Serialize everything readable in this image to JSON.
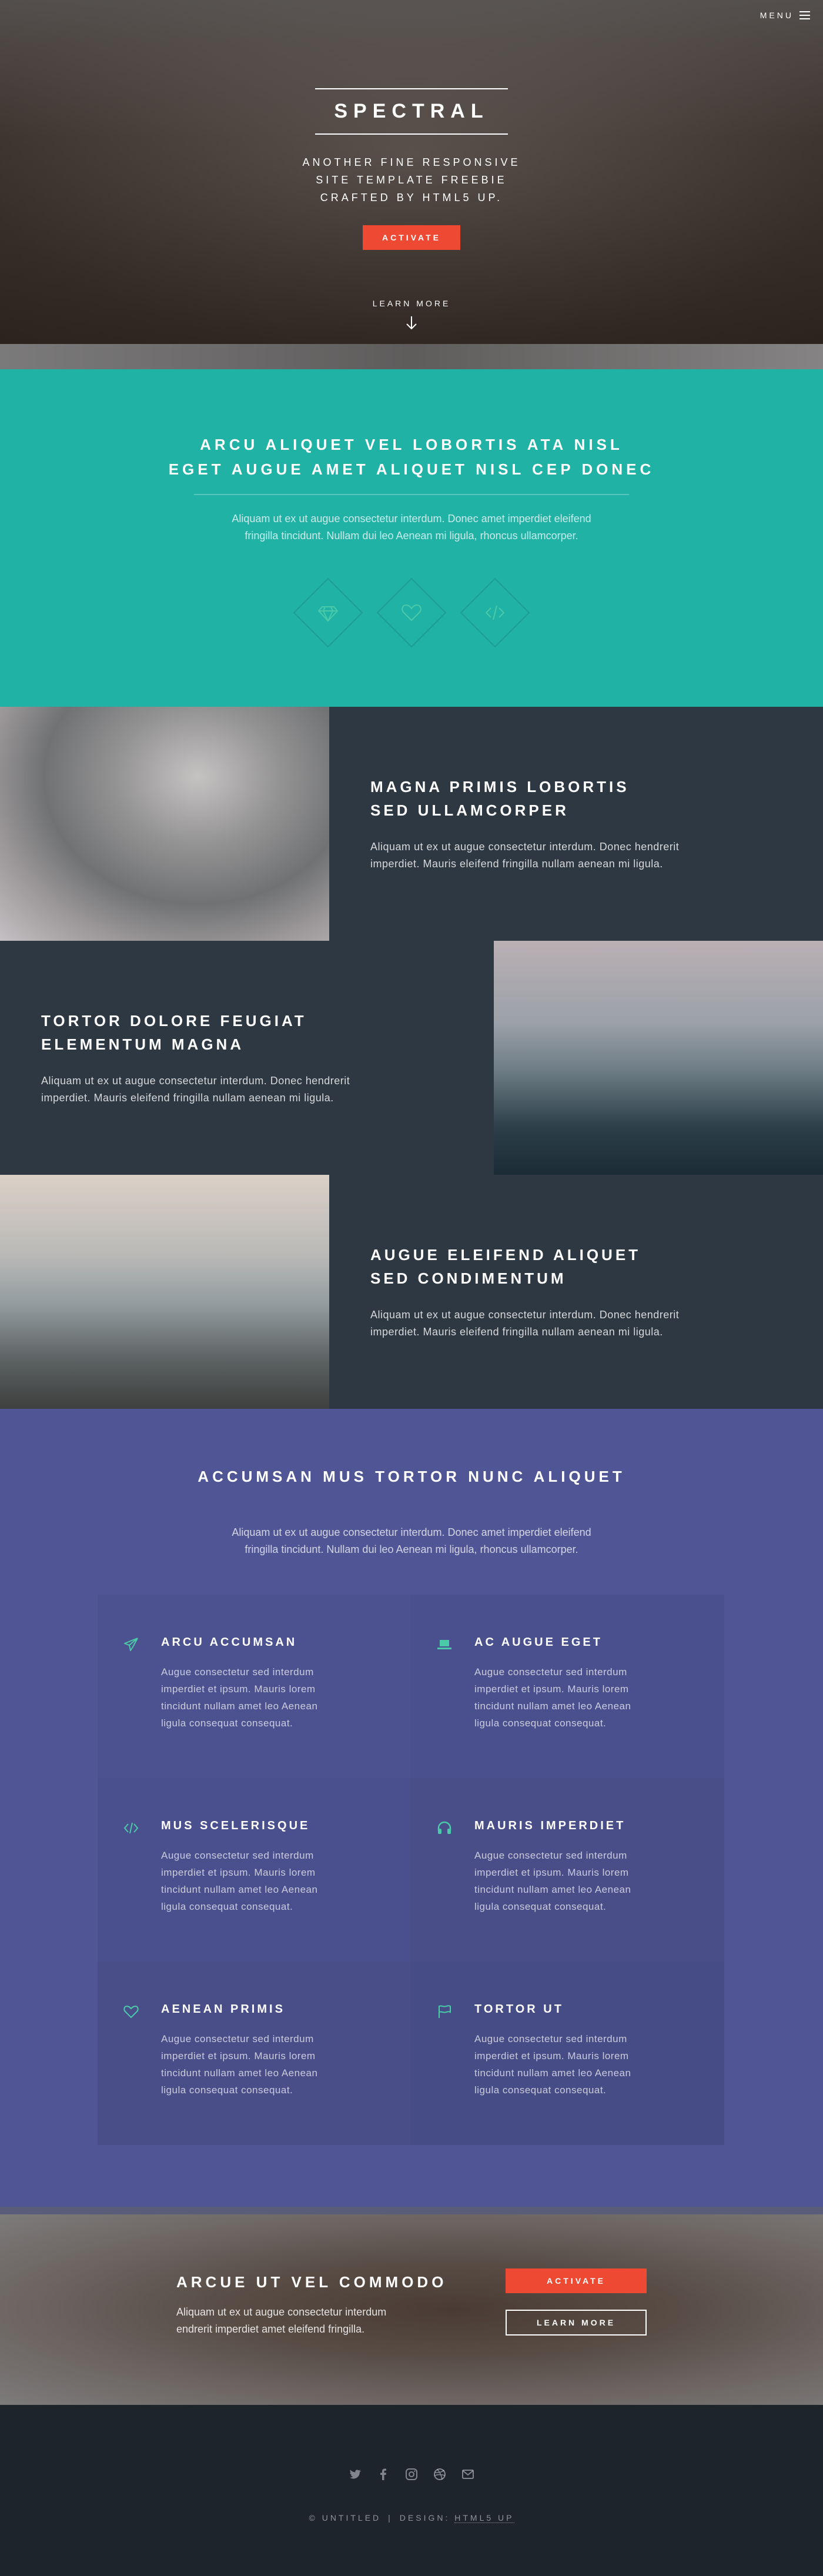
{
  "colors": {
    "accent": "#ed4933",
    "teal": "#21b2a6",
    "purple": "#4f5595",
    "dark": "#2e3842",
    "footer": "#1d242a",
    "icon_teal": "#4acaa8"
  },
  "header": {
    "menu_label": "MENU",
    "menu_icon": "hamburger-icon"
  },
  "banner": {
    "title": "SPECTRAL",
    "tagline_lines": [
      "ANOTHER FINE RESPONSIVE",
      "SITE TEMPLATE FREEBIE",
      "CRAFTED BY HTML5 UP."
    ],
    "activate_label": "ACTIVATE",
    "learn_more_label": "LEARN MORE",
    "learn_more_icon": "arrow-down-icon"
  },
  "one": {
    "heading_lines": [
      "ARCU ALIQUET VEL LOBORTIS ATA NISL",
      "EGET AUGUE AMET ALIQUET NISL CEP DONEC"
    ],
    "text_lines": [
      "Aliquam ut ex ut augue consectetur interdum. Donec amet imperdiet eleifend",
      "fringilla tincidunt. Nullam dui leo Aenean mi ligula, rhoncus ullamcorper."
    ],
    "icons": [
      "diamond-icon",
      "heart-icon",
      "code-icon"
    ]
  },
  "spotlights": [
    {
      "title_lines": [
        "MAGNA PRIMIS LOBORTIS",
        "SED ULLAMCORPER"
      ],
      "text_lines": [
        "Aliquam ut ex ut augue consectetur interdum. Donec hendrerit",
        "imperdiet. Mauris eleifend fringilla nullam aenean mi ligula."
      ]
    },
    {
      "title_lines": [
        "TORTOR DOLORE FEUGIAT",
        "ELEMENTUM MAGNA"
      ],
      "text_lines": [
        "Aliquam ut ex ut augue consectetur interdum. Donec hendrerit",
        "imperdiet. Mauris eleifend fringilla nullam aenean mi ligula."
      ]
    },
    {
      "title_lines": [
        "AUGUE ELEIFEND ALIQUET",
        "SED CONDIMENTUM"
      ],
      "text_lines": [
        "Aliquam ut ex ut augue consectetur interdum. Donec hendrerit",
        "imperdiet. Mauris eleifend fringilla nullam aenean mi ligula."
      ]
    }
  ],
  "three": {
    "heading": "ACCUMSAN MUS TORTOR NUNC ALIQUET",
    "text_lines": [
      "Aliquam ut ex ut augue consectetur interdum. Donec amet imperdiet eleifend",
      "fringilla tincidunt. Nullam dui leo Aenean mi ligula, rhoncus ullamcorper."
    ],
    "features": [
      {
        "icon": "paper-plane-icon",
        "title": "ARCU ACCUMSAN",
        "text_lines": [
          "Augue consectetur sed interdum",
          "imperdiet et ipsum. Mauris lorem",
          "tincidunt nullam amet leo Aenean",
          "ligula consequat consequat."
        ]
      },
      {
        "icon": "laptop-icon",
        "title": "AC AUGUE EGET",
        "text_lines": [
          "Augue consectetur sed interdum",
          "imperdiet et ipsum. Mauris lorem",
          "tincidunt nullam amet leo Aenean",
          "ligula consequat consequat."
        ]
      },
      {
        "icon": "code-icon",
        "title": "MUS SCELERISQUE",
        "text_lines": [
          "Augue consectetur sed interdum",
          "imperdiet et ipsum. Mauris lorem",
          "tincidunt nullam amet leo Aenean",
          "ligula consequat consequat."
        ]
      },
      {
        "icon": "headphones-icon",
        "title": "MAURIS IMPERDIET",
        "text_lines": [
          "Augue consectetur sed interdum",
          "imperdiet et ipsum. Mauris lorem",
          "tincidunt nullam amet leo Aenean",
          "ligula consequat consequat."
        ]
      },
      {
        "icon": "heart-icon",
        "title": "AENEAN PRIMIS",
        "text_lines": [
          "Augue consectetur sed interdum",
          "imperdiet et ipsum. Mauris lorem",
          "tincidunt nullam amet leo Aenean",
          "ligula consequat consequat."
        ]
      },
      {
        "icon": "flag-icon",
        "title": "TORTOR UT",
        "text_lines": [
          "Augue consectetur sed interdum",
          "imperdiet et ipsum. Mauris lorem",
          "tincidunt nullam amet leo Aenean",
          "ligula consequat consequat."
        ]
      }
    ]
  },
  "cta": {
    "heading": "ARCUE UT VEL COMMODO",
    "text_lines": [
      "Aliquam ut ex ut augue consectetur interdum",
      "endrerit imperdiet amet eleifend fringilla."
    ],
    "activate_label": "ACTIVATE",
    "learn_more_label": "LEARN MORE"
  },
  "footer": {
    "social_icons": [
      "twitter-icon",
      "facebook-icon",
      "instagram-icon",
      "dribbble-icon",
      "envelope-icon"
    ],
    "copyright": "© UNTITLED",
    "design_prefix": "DESIGN:",
    "design_link": "HTML5 UP"
  }
}
